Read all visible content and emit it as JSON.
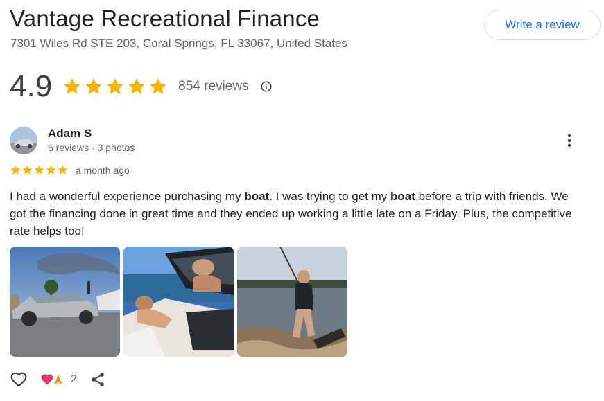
{
  "business": {
    "name": "Vantage Recreational Finance",
    "address": "7301 Wiles Rd STE 203, Coral Springs, FL 33067, United States",
    "write_review_label": "Write a review"
  },
  "rating": {
    "value": "4.9",
    "stars": 5,
    "count_label": "854 reviews"
  },
  "review": {
    "author": "Adam S",
    "meta": "6 reviews · 3 photos",
    "stars": 5,
    "date": "a month ago",
    "text_parts": [
      {
        "text": "I had a wonderful experience purchasing my ",
        "bold": false
      },
      {
        "text": "boat",
        "bold": true
      },
      {
        "text": ". I was trying to get my ",
        "bold": false
      },
      {
        "text": "boat",
        "bold": true
      },
      {
        "text": " before a trip with friends. We got the financing done in great time and they ended up working a little late on a Friday. Plus, the competitive rate helps too!",
        "bold": false
      }
    ],
    "reaction_count": "2"
  },
  "colors": {
    "star": "#f4b400",
    "accent": "#1a73e8",
    "text_primary": "#202124",
    "text_secondary": "#5f6368"
  },
  "icons": {
    "star": "star-icon",
    "info": "info-icon",
    "more": "more-vert-icon",
    "like": "heart-outline-icon",
    "share": "share-icon"
  }
}
